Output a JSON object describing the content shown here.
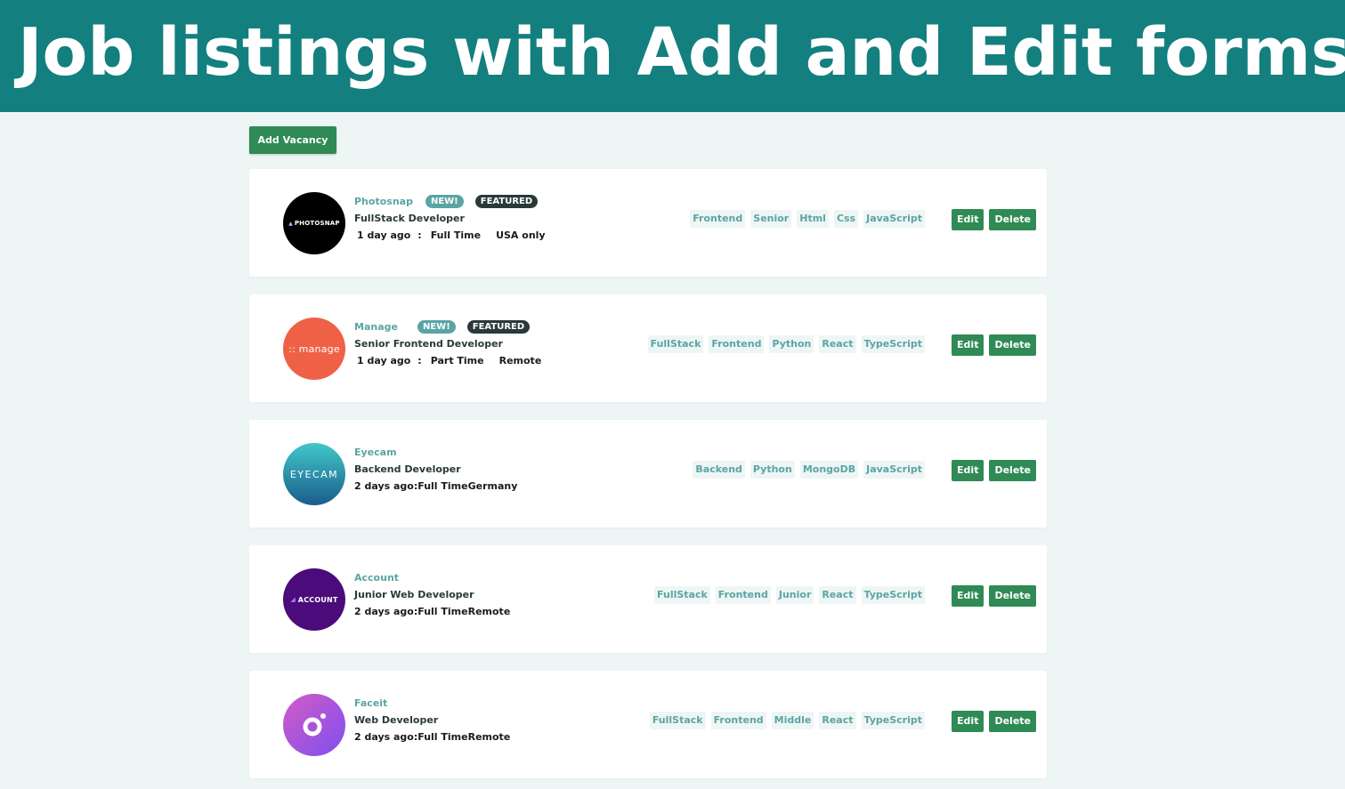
{
  "header": {
    "title": "Job listings with Add and Edit forms"
  },
  "toolbar": {
    "add_label": "Add Vacancy"
  },
  "colors": {
    "banner": "#137f7f",
    "primary_cyan": "#5ba4a4",
    "dark_cyan": "#2b3939",
    "button_green": "#2f8a55",
    "background": "#eef6f5"
  },
  "actions": {
    "edit_label": "Edit",
    "delete_label": "Delete"
  },
  "jobs": [
    {
      "company": "Photosnap",
      "logo_text": "PHOTOSNAP",
      "logo_color": "#000000",
      "is_new": true,
      "new_label": "NEW!",
      "featured": true,
      "featured_label": "FEATURED",
      "position": "FullStack Developer",
      "posted": "1 day ago",
      "separator": ":",
      "contract": "Full Time",
      "location": "USA only",
      "meta_compact": "",
      "tags": [
        "Frontend",
        "Senior",
        "Html",
        "Css",
        "JavaScript"
      ]
    },
    {
      "company": "Manage",
      "logo_text": ":: manage",
      "logo_color": "#ef6147",
      "is_new": true,
      "new_label": "NEW!",
      "featured": true,
      "featured_label": "FEATURED",
      "position": "Senior Frontend Developer",
      "posted": "1 day ago",
      "separator": ":",
      "contract": "Part Time",
      "location": "Remote",
      "meta_compact": "",
      "tags": [
        "FullStack",
        "Frontend",
        "Python",
        "React",
        "TypeScript"
      ]
    },
    {
      "company": "Eyecam",
      "logo_text": "EYECAM",
      "logo_color": "#2aa7b1",
      "is_new": false,
      "featured": false,
      "position": "Backend Developer",
      "meta_compact": "2 days ago:Full TimeGermany",
      "tags": [
        "Backend",
        "Python",
        "MongoDB",
        "JavaScript"
      ]
    },
    {
      "company": "Account",
      "logo_text": "ACCOUNT",
      "logo_color": "#4b0b7a",
      "is_new": false,
      "featured": false,
      "position": "Junior Web Developer",
      "meta_compact": "2 days ago:Full TimeRemote",
      "tags": [
        "FullStack",
        "Frontend",
        "Junior",
        "React",
        "TypeScript"
      ]
    },
    {
      "company": "Faceit",
      "logo_text": "",
      "logo_color": "#b05ad6",
      "is_new": false,
      "featured": false,
      "position": "Web Developer",
      "meta_compact": "2 days ago:Full TimeRemote",
      "tags": [
        "FullStack",
        "Frontend",
        "Middle",
        "React",
        "TypeScript"
      ]
    }
  ]
}
